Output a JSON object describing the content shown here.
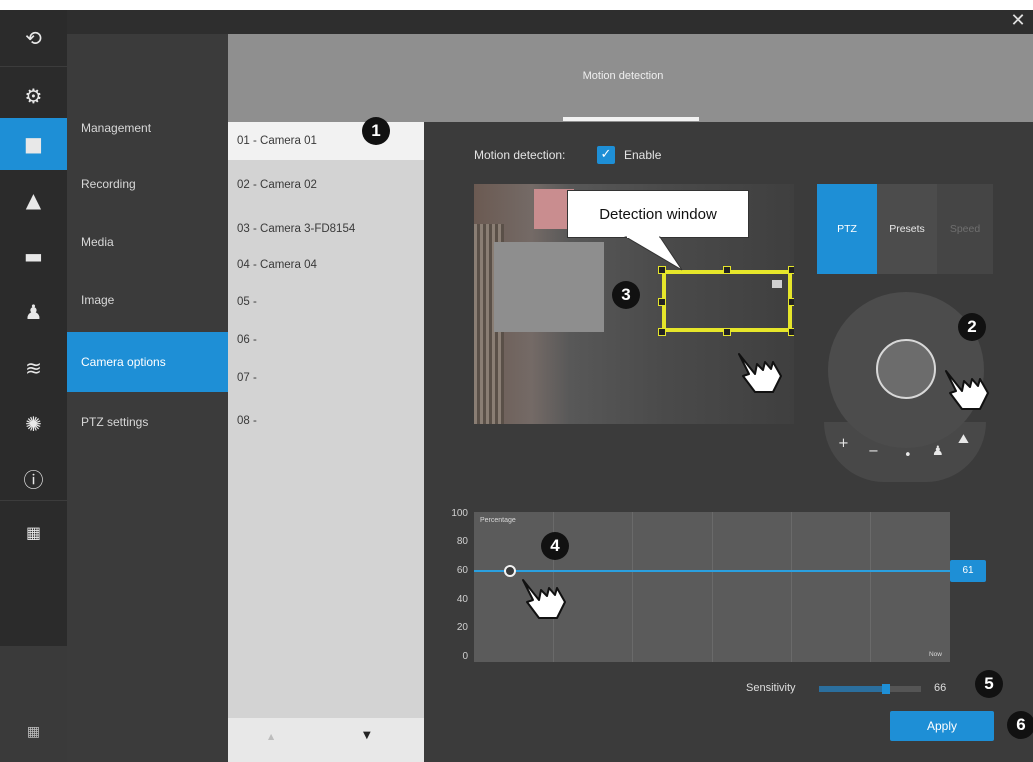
{
  "window": {
    "close_glyph": "✕"
  },
  "rail": {
    "items": [
      {
        "icon": "back-icon",
        "glyph": "⟲"
      },
      {
        "icon": "gear-icon",
        "glyph": "⚙"
      },
      {
        "icon": "camera-icon",
        "glyph": "■",
        "active": true
      },
      {
        "icon": "alarm-icon",
        "glyph": "▲"
      },
      {
        "icon": "monitor-icon",
        "glyph": "▬"
      },
      {
        "icon": "user-icon",
        "glyph": "♟"
      },
      {
        "icon": "database-icon",
        "glyph": "≋"
      },
      {
        "icon": "network-icon",
        "glyph": "✺"
      },
      {
        "icon": "info-icon",
        "glyph": "ⓘ"
      },
      {
        "icon": "calendar-icon",
        "glyph": "▦"
      }
    ],
    "bottom_icon": {
      "icon": "grid-icon",
      "glyph": "▦"
    }
  },
  "menu": {
    "items": [
      {
        "label": "Management"
      },
      {
        "label": "Recording"
      },
      {
        "label": "Media"
      },
      {
        "label": "Image"
      },
      {
        "label": "Camera options",
        "active": true
      },
      {
        "label": "PTZ settings"
      }
    ]
  },
  "header": {
    "tab_label": "Motion detection"
  },
  "cameras": {
    "items": [
      {
        "label": "01 - Camera 01",
        "active": true
      },
      {
        "label": "02 - Camera 02"
      },
      {
        "label": "03 - Camera 3-FD8154"
      },
      {
        "label": "04 - Camera 04"
      },
      {
        "label": "05 -"
      },
      {
        "label": "06 -"
      },
      {
        "label": "07 -"
      },
      {
        "label": "08 -"
      }
    ],
    "up_glyph": "▲",
    "down_glyph": "▼"
  },
  "motion": {
    "label": "Motion detection:",
    "enabled": true,
    "check_glyph": "✓",
    "enable_label": "Enable"
  },
  "callout_text": "Detection window",
  "ptz": {
    "tabs": [
      {
        "label": "PTZ",
        "state": "active"
      },
      {
        "label": "Presets",
        "state": "normal"
      },
      {
        "label": "Speed",
        "state": "dim"
      }
    ],
    "controls": [
      {
        "icon": "zoom-in-icon",
        "glyph": "+"
      },
      {
        "icon": "zoom-out-icon",
        "glyph": "−"
      },
      {
        "icon": "focus-icon",
        "glyph": "•"
      },
      {
        "icon": "home-icon",
        "glyph": "♟"
      },
      {
        "icon": "image-icon",
        "glyph": "⛰"
      }
    ]
  },
  "chart": {
    "y_ticks": [
      "100",
      "80",
      "60",
      "40",
      "20",
      "0"
    ],
    "title": "Percentage",
    "x_end_label": "Now",
    "threshold": 61,
    "threshold_label": "61"
  },
  "sensitivity": {
    "label": "Sensitivity",
    "value": 66,
    "value_label": "66"
  },
  "apply_label": "Apply",
  "callout_numbers": [
    "1",
    "2",
    "3",
    "4",
    "5",
    "6"
  ]
}
